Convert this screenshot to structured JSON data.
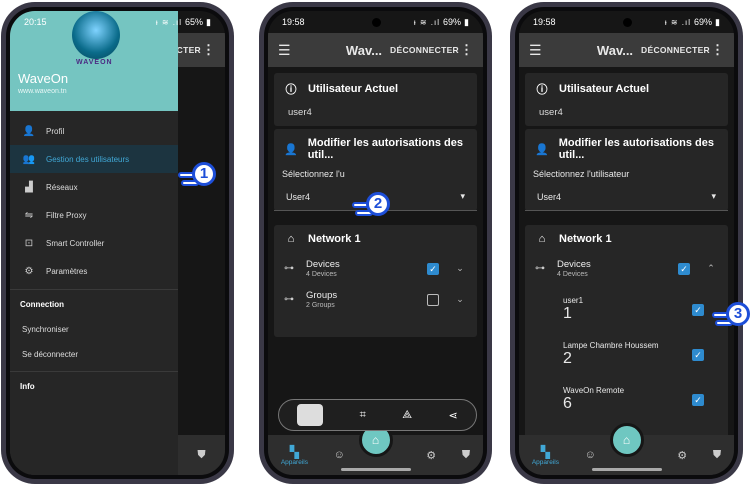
{
  "phone1": {
    "status": {
      "time": "20:15",
      "icons_left": "▲ ▣ ●",
      "battery": "65%"
    },
    "appbar_action": "CCTER",
    "drawer": {
      "logo_text": "WAVEON",
      "app_name": "WaveOn",
      "url": "www.waveon.tn",
      "items": [
        {
          "icon": "person-icon",
          "label": "Profil"
        },
        {
          "icon": "users-icon",
          "label": "Gestion des utilisateurs"
        },
        {
          "icon": "network-icon",
          "label": "Réseaux"
        },
        {
          "icon": "proxy-icon",
          "label": "Filtre Proxy"
        },
        {
          "icon": "controller-icon",
          "label": "Smart Controller"
        },
        {
          "icon": "gear-icon",
          "label": "Paramètres"
        }
      ],
      "section_connection": "Connection",
      "sync": "Synchroniser",
      "logout": "Se déconnecter",
      "section_info": "Info"
    },
    "step": "1"
  },
  "phone2": {
    "status": {
      "time": "19:58",
      "icons_left": "▣ ● ●",
      "battery": "69%"
    },
    "appbar": {
      "title": "Wav...",
      "action": "DÉCONNECTER"
    },
    "current_user": {
      "title": "Utilisateur Actuel",
      "value": "user4"
    },
    "modify": {
      "title": "Modifier les autorisations des util...",
      "label": "Sélectionnez l'u",
      "selected": "User4"
    },
    "network": {
      "title": "Network 1",
      "devices": "Devices",
      "devices_count": "4 Devices",
      "groups": "Groups",
      "groups_count": "2 Groups"
    },
    "step": "2"
  },
  "phone3": {
    "status": {
      "time": "19:58",
      "icons_left": "▣ ● ●",
      "battery": "69%"
    },
    "appbar": {
      "title": "Wav...",
      "action": "DÉCONNECTER"
    },
    "current_user": {
      "title": "Utilisateur Actuel",
      "value": "user4"
    },
    "modify": {
      "title": "Modifier les autorisations des util...",
      "label": "Sélectionnez l'utilisateur",
      "selected": "User4"
    },
    "network": {
      "title": "Network 1",
      "devices": "Devices",
      "devices_count": "4 Devices"
    },
    "subitems": [
      {
        "name": "user1",
        "id": "1"
      },
      {
        "name": "Lampe Chambre Houssem",
        "id": "2"
      },
      {
        "name": "WaveOn Remote",
        "id": "6"
      }
    ],
    "nav_label": "Appareils",
    "step": "3"
  },
  "nav_label": "Appareils"
}
